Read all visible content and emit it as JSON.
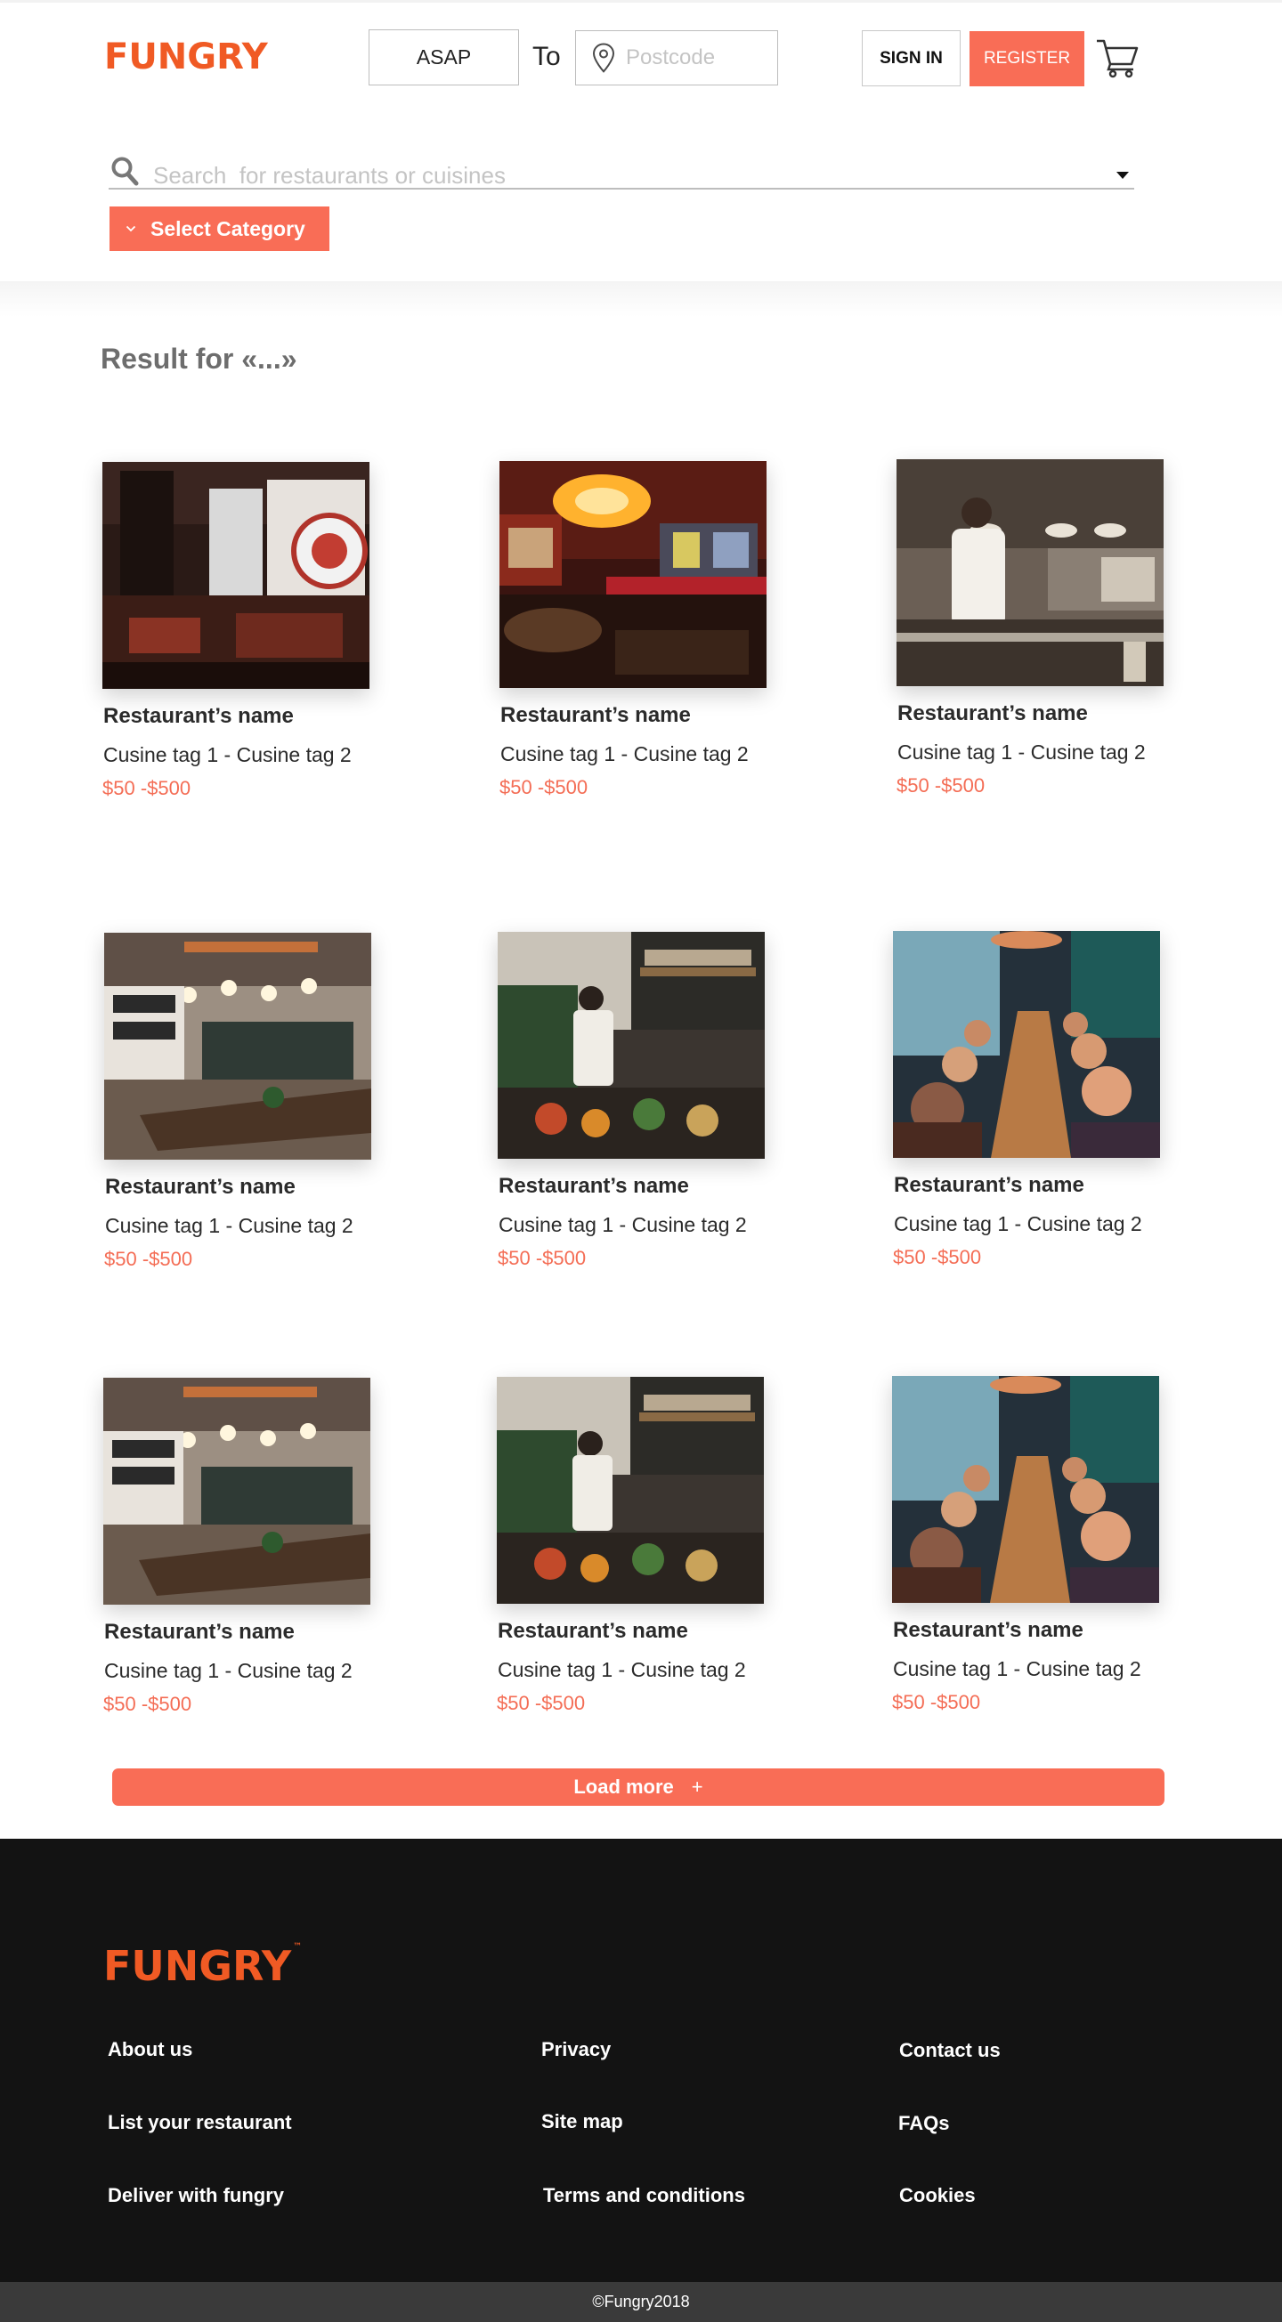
{
  "header": {
    "logo": "FUNGRY",
    "time_value": "ASAP",
    "to_label": "To",
    "postcode_placeholder": "Postcode",
    "signin_label": "SIGN IN",
    "register_label": "REGISTER",
    "cart_icon": "shopping-cart-icon"
  },
  "search": {
    "placeholder": "Search  for restaurants or cuisines",
    "category_label": "Select Category",
    "search_icon": "search-icon"
  },
  "results": {
    "title": "Result for «...»",
    "cards": [
      {
        "name": "Restaurant’s  name",
        "tags": "Cusine tag 1 - Cusine tag 2",
        "price": "$50 -$500",
        "photo": "restaurant-interior-photo"
      },
      {
        "name": "Restaurant’s  name",
        "tags": "Cusine tag 1 - Cusine tag 2",
        "price": "$50 -$500",
        "photo": "restaurant-interior-photo"
      },
      {
        "name": "Restaurant’s  name",
        "tags": "Cusine tag 1 - Cusine tag 2",
        "price": "$50 -$500",
        "photo": "kitchen-chef-photo"
      },
      {
        "name": "Restaurant’s  name",
        "tags": "Cusine tag 1 - Cusine tag 2",
        "price": "$50 -$500",
        "photo": "cafe-interior-photo"
      },
      {
        "name": "Restaurant’s  name",
        "tags": "Cusine tag 1 - Cusine tag 2",
        "price": "$50 -$500",
        "photo": "deli-counter-photo"
      },
      {
        "name": "Restaurant’s  name",
        "tags": "Cusine tag 1 - Cusine tag 2",
        "price": "$50 -$500",
        "photo": "diners-table-photo"
      },
      {
        "name": "Restaurant’s  name",
        "tags": "Cusine tag 1 - Cusine tag 2",
        "price": "$50 -$500",
        "photo": "cafe-interior-photo"
      },
      {
        "name": "Restaurant’s  name",
        "tags": "Cusine tag 1 - Cusine tag 2",
        "price": "$50 -$500",
        "photo": "deli-counter-photo"
      },
      {
        "name": "Restaurant’s  name",
        "tags": "Cusine tag 1 - Cusine tag 2",
        "price": "$50 -$500",
        "photo": "diners-table-photo"
      }
    ],
    "load_more_label": "Load more",
    "load_more_icon": "+"
  },
  "footer": {
    "logo": "FUNGRY",
    "tm": "™",
    "links": [
      "About us",
      "Privacy",
      "Contact us",
      "List your restaurant",
      "Site map",
      "FAQs",
      "Deliver with fungry",
      "Terms and conditions",
      "Cookies"
    ],
    "copyright": "©Fungry2018"
  },
  "colors": {
    "brand": "#f05a24",
    "accent": "#f96d56",
    "price": "#f46d55",
    "footer_bg": "#131313",
    "copyright_bg": "#3a3a3a"
  }
}
